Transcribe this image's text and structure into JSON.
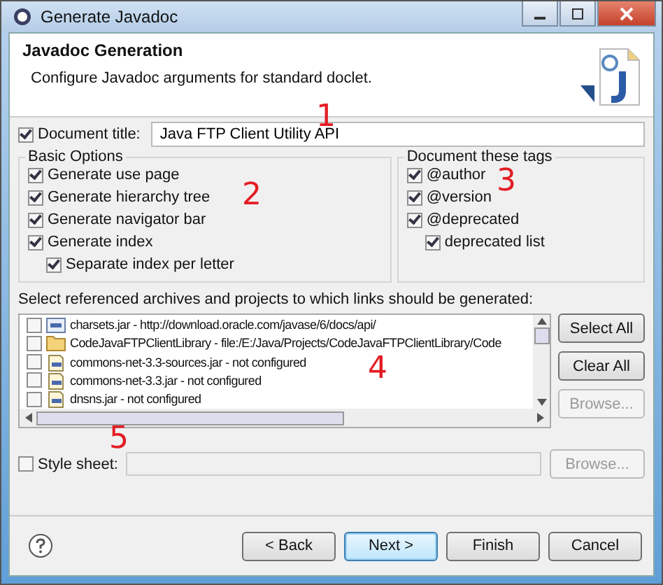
{
  "window": {
    "title": "Generate Javadoc"
  },
  "header": {
    "title": "Javadoc Generation",
    "description": "Configure Javadoc arguments for standard doclet."
  },
  "document_title": {
    "label": "Document title:",
    "checked": true,
    "value": "Java FTP Client Utility API"
  },
  "basic_options": {
    "title": "Basic Options",
    "items": [
      {
        "label": "Generate use page",
        "checked": true,
        "indented": false
      },
      {
        "label": "Generate hierarchy tree",
        "checked": true,
        "indented": false
      },
      {
        "label": "Generate navigator bar",
        "checked": true,
        "indented": false
      },
      {
        "label": "Generate index",
        "checked": true,
        "indented": false
      },
      {
        "label": "Separate index per letter",
        "checked": true,
        "indented": true
      }
    ]
  },
  "document_tags": {
    "title": "Document these tags",
    "items": [
      {
        "label": "@author",
        "checked": true,
        "indented": false
      },
      {
        "label": "@version",
        "checked": true,
        "indented": false
      },
      {
        "label": "@deprecated",
        "checked": true,
        "indented": false
      },
      {
        "label": "deprecated list",
        "checked": true,
        "indented": true
      }
    ]
  },
  "links": {
    "label": "Select referenced archives and projects to which links should be generated:",
    "items": [
      {
        "kind": "web-jar",
        "label": "charsets.jar - http://download.oracle.com/javase/6/docs/api/",
        "checked": false
      },
      {
        "kind": "folder",
        "label": "CodeJavaFTPClientLibrary - file:/E:/Java/Projects/CodeJavaFTPClientLibrary/Code",
        "checked": false
      },
      {
        "kind": "jar",
        "label": "commons-net-3.3-sources.jar - not configured",
        "checked": false
      },
      {
        "kind": "jar",
        "label": "commons-net-3.3.jar - not configured",
        "checked": false
      },
      {
        "kind": "jar",
        "label": "dnsns.jar - not configured",
        "checked": false
      }
    ],
    "buttons": [
      {
        "label": "Select All",
        "disabled": false
      },
      {
        "label": "Clear All",
        "disabled": false
      },
      {
        "label": "Browse...",
        "disabled": true
      }
    ]
  },
  "style_sheet": {
    "label": "Style sheet:",
    "checked": false,
    "browse": {
      "label": "Browse...",
      "disabled": true
    }
  },
  "annotations": [
    "1",
    "2",
    "3",
    "4",
    "5"
  ],
  "buttons": [
    {
      "label": "< Back",
      "default": false
    },
    {
      "label": "Next >",
      "default": true
    },
    {
      "label": "Finish",
      "default": false
    },
    {
      "label": "Cancel",
      "default": false
    }
  ]
}
